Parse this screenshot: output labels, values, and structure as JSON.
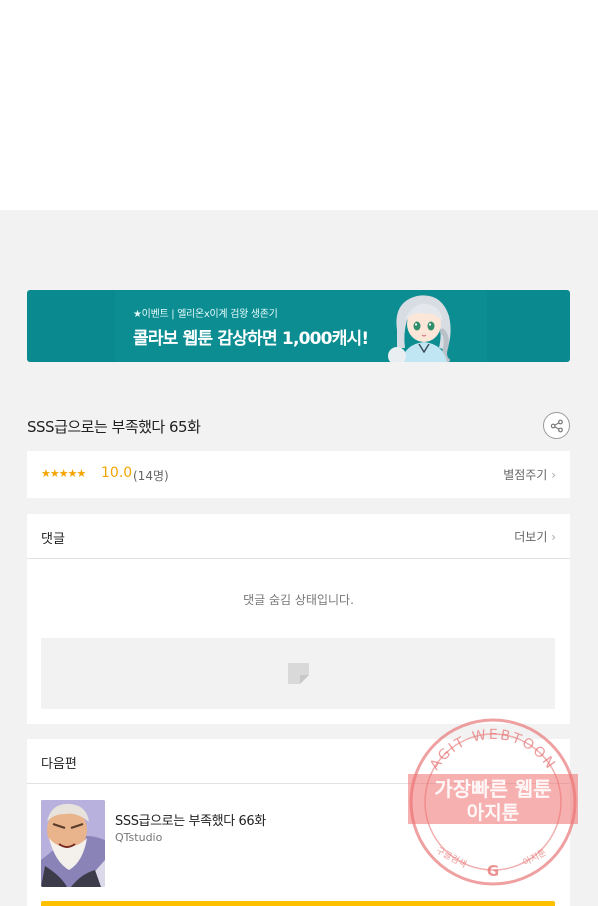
{
  "banner": {
    "tag": "★이벤트 | 엘리온x이계 검왕 생존기",
    "headline": "콜라보 웹툰 감상하면 1,000캐시!"
  },
  "episode": {
    "title": "SSS급으로는 부족했다 65화"
  },
  "rating": {
    "stars": "★★★★★",
    "score": "10.0",
    "count": "(14명)",
    "action": "별점주기"
  },
  "comments": {
    "label": "댓글",
    "more": "더보기",
    "hidden_message": "댓글 숨김 상태입니다."
  },
  "next": {
    "label": "다음편",
    "title": "SSS급으로는 부족했다 66화",
    "author": "QTstudio"
  },
  "watermark": {
    "ring_text": "AGIT WEBTOON",
    "line1": "가장빠른 웹툰",
    "line2": "아지툰",
    "bottom_left": "구글검색",
    "bottom_right": "아지툰"
  },
  "colors": {
    "banner": "#0a8a8f",
    "star": "#f4a400",
    "accent_bar": "#ffc000",
    "watermark": "#e8797a"
  }
}
